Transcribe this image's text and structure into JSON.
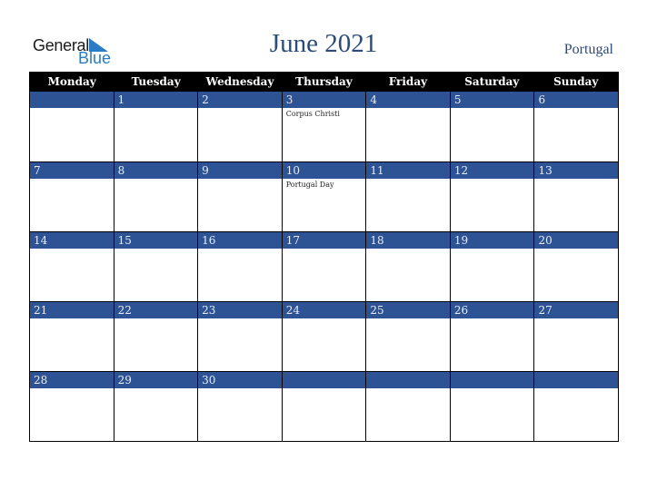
{
  "logo": {
    "word1": "General",
    "word2": "Blue"
  },
  "header": {
    "title": "June 2021",
    "country": "Portugal"
  },
  "colors": {
    "accent": "#2e5394",
    "header_bg": "#000000",
    "title": "#2c4b7a",
    "logo_blue": "#2a7dc4"
  },
  "weekdays": [
    "Monday",
    "Tuesday",
    "Wednesday",
    "Thursday",
    "Friday",
    "Saturday",
    "Sunday"
  ],
  "weeks": [
    [
      {
        "day": "",
        "event": ""
      },
      {
        "day": "1",
        "event": ""
      },
      {
        "day": "2",
        "event": ""
      },
      {
        "day": "3",
        "event": "Corpus Christi"
      },
      {
        "day": "4",
        "event": ""
      },
      {
        "day": "5",
        "event": ""
      },
      {
        "day": "6",
        "event": ""
      }
    ],
    [
      {
        "day": "7",
        "event": ""
      },
      {
        "day": "8",
        "event": ""
      },
      {
        "day": "9",
        "event": ""
      },
      {
        "day": "10",
        "event": "Portugal Day"
      },
      {
        "day": "11",
        "event": ""
      },
      {
        "day": "12",
        "event": ""
      },
      {
        "day": "13",
        "event": ""
      }
    ],
    [
      {
        "day": "14",
        "event": ""
      },
      {
        "day": "15",
        "event": ""
      },
      {
        "day": "16",
        "event": ""
      },
      {
        "day": "17",
        "event": ""
      },
      {
        "day": "18",
        "event": ""
      },
      {
        "day": "19",
        "event": ""
      },
      {
        "day": "20",
        "event": ""
      }
    ],
    [
      {
        "day": "21",
        "event": ""
      },
      {
        "day": "22",
        "event": ""
      },
      {
        "day": "23",
        "event": ""
      },
      {
        "day": "24",
        "event": ""
      },
      {
        "day": "25",
        "event": ""
      },
      {
        "day": "26",
        "event": ""
      },
      {
        "day": "27",
        "event": ""
      }
    ],
    [
      {
        "day": "28",
        "event": ""
      },
      {
        "day": "29",
        "event": ""
      },
      {
        "day": "30",
        "event": ""
      },
      {
        "day": "",
        "event": ""
      },
      {
        "day": "",
        "event": ""
      },
      {
        "day": "",
        "event": ""
      },
      {
        "day": "",
        "event": ""
      }
    ]
  ]
}
